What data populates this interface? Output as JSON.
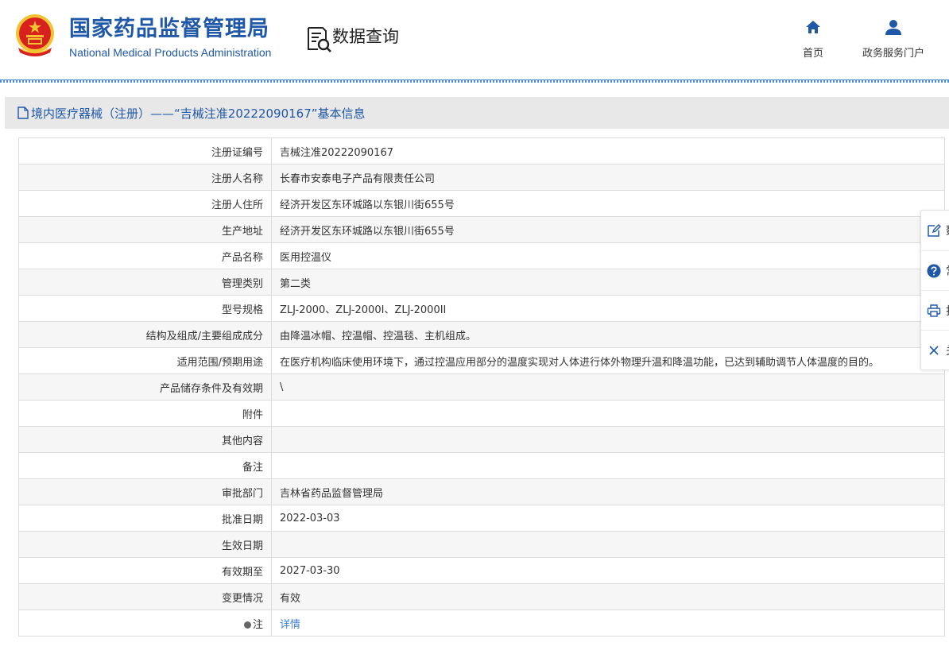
{
  "header": {
    "logo_cn": "国家药品监督管理局",
    "logo_en": "National Medical Products Administration",
    "query_title": "数据查询",
    "nav": [
      {
        "label": "首页",
        "icon": "home-icon"
      },
      {
        "label": "政务服务门户",
        "icon": "user-icon"
      }
    ]
  },
  "section": {
    "title": "境内医疗器械（注册）——“吉械注准20222090167”基本信息"
  },
  "table": {
    "rows": [
      {
        "label": "注册证编号",
        "value": "吉械注准20222090167"
      },
      {
        "label": "注册人名称",
        "value": "长春市安泰电子产品有限责任公司"
      },
      {
        "label": "注册人住所",
        "value": "经济开发区东环城路以东银川街655号"
      },
      {
        "label": "生产地址",
        "value": "经济开发区东环城路以东银川街655号"
      },
      {
        "label": "产品名称",
        "value": "医用控温仪"
      },
      {
        "label": "管理类别",
        "value": "第二类"
      },
      {
        "label": "型号规格",
        "value": "ZLJ-2000、ZLJ-2000I、ZLJ-2000II"
      },
      {
        "label": "结构及组成/主要组成成分",
        "value": "由降温冰帽、控温帽、控温毯、主机组成。"
      },
      {
        "label": "适用范围/预期用途",
        "value": "在医疗机构临床使用环境下，通过控温应用部分的温度实现对人体进行体外物理升温和降温功能，已达到辅助调节人体温度的目的。"
      },
      {
        "label": "产品储存条件及有效期",
        "value": "\\"
      },
      {
        "label": "附件",
        "value": ""
      },
      {
        "label": "其他内容",
        "value": ""
      },
      {
        "label": "备注",
        "value": ""
      },
      {
        "label": "审批部门",
        "value": "吉林省药品监督管理局"
      },
      {
        "label": "批准日期",
        "value": "2022-03-03"
      },
      {
        "label": "生效日期",
        "value": ""
      },
      {
        "label": "有效期至",
        "value": "2027-03-30"
      },
      {
        "label": "变更情况",
        "value": "有效"
      }
    ],
    "note_row": {
      "label": "注",
      "link": "详情"
    }
  },
  "float_bar": {
    "items": [
      {
        "label": "数",
        "icon": "edit-icon"
      },
      {
        "label": "常",
        "icon": "help-icon"
      },
      {
        "label": "打",
        "icon": "print-icon"
      },
      {
        "label": "关",
        "icon": "close-icon"
      }
    ]
  },
  "colors": {
    "brand_blue": "#1f58a8",
    "link_blue": "#3b7ed1",
    "section_bg": "#e8e8e8",
    "emblem_red": "#d8201f",
    "emblem_gold": "#f2c230"
  }
}
